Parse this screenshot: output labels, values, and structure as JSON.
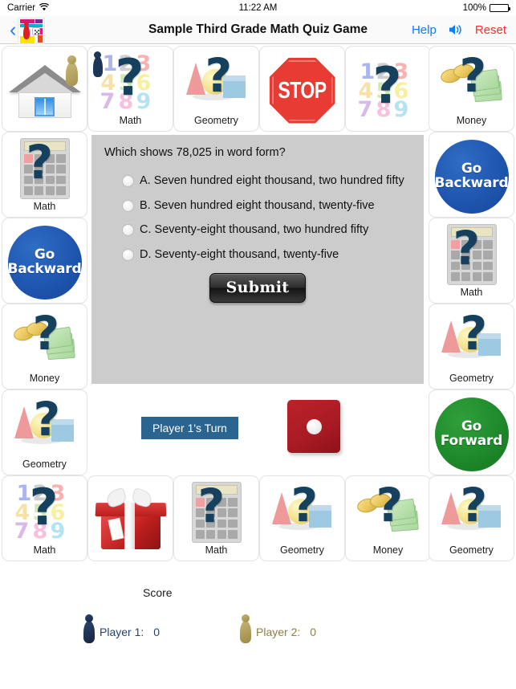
{
  "status_bar": {
    "carrier": "Carrier",
    "wifi_icon": "wifi-icon",
    "time": "11:22 AM",
    "battery_percent": "100%",
    "battery_icon": "battery-full-icon"
  },
  "nav_bar": {
    "back_icon": "back-chevron-icon",
    "app_icon": "board-game-app-icon",
    "title": "Sample Third Grade Math Quiz Game",
    "help_label": "Help",
    "sound_icon": "speaker-on-icon",
    "reset_label": "Reset"
  },
  "board": {
    "tiles": [
      {
        "id": "home",
        "label": "",
        "art": "house",
        "row": 0,
        "col": 0
      },
      {
        "id": "math-top-1",
        "label": "Math",
        "art": "numbers",
        "row": 0,
        "col": 1,
        "pawn": true
      },
      {
        "id": "geometry-top",
        "label": "Geometry",
        "art": "geometry",
        "row": 0,
        "col": 2
      },
      {
        "id": "stop",
        "label": "",
        "art": "stop",
        "row": 0,
        "col": 3
      },
      {
        "id": "math-top-2",
        "label": "",
        "art": "numbers",
        "row": 0,
        "col": 4
      },
      {
        "id": "money-top",
        "label": "Money",
        "art": "money",
        "row": 0,
        "col": 5
      },
      {
        "id": "math-left-1",
        "label": "Math",
        "art": "calc",
        "row": 1,
        "col": 0
      },
      {
        "id": "go-backward-left",
        "label": "Go Backward",
        "art": "circle-blue",
        "row": 2,
        "col": 0
      },
      {
        "id": "money-left",
        "label": "Money",
        "art": "money",
        "row": 3,
        "col": 0
      },
      {
        "id": "geometry-left",
        "label": "Geometry",
        "art": "geometry",
        "row": 4,
        "col": 0
      },
      {
        "id": "go-backward-right",
        "label": "Go Backward",
        "art": "circle-blue",
        "row": 1,
        "col": 5
      },
      {
        "id": "math-right",
        "label": "Math",
        "art": "calc",
        "row": 2,
        "col": 5
      },
      {
        "id": "geometry-right",
        "label": "Geometry",
        "art": "geometry",
        "row": 3,
        "col": 5
      },
      {
        "id": "go-forward",
        "label": "Go Forward",
        "art": "circle-green",
        "row": 4,
        "col": 5
      },
      {
        "id": "math-bot-1",
        "label": "Math",
        "art": "numbers",
        "row": 5,
        "col": 0
      },
      {
        "id": "gift",
        "label": "",
        "art": "gift",
        "row": 5,
        "col": 1
      },
      {
        "id": "math-bot-2",
        "label": "Math",
        "art": "calc",
        "row": 5,
        "col": 2
      },
      {
        "id": "geometry-bot-1",
        "label": "Geometry",
        "art": "geometry",
        "row": 5,
        "col": 3
      },
      {
        "id": "money-bot",
        "label": "Money",
        "art": "money",
        "row": 5,
        "col": 4
      },
      {
        "id": "geometry-bot-2",
        "label": "Geometry",
        "art": "geometry",
        "row": 5,
        "col": 5
      }
    ],
    "go_backward_label": "Go Backward",
    "go_forward_label": "Go Forward",
    "stop_label": "STOP"
  },
  "question": {
    "prompt": "Which shows 78,025 in word form?",
    "answers": [
      "A. Seven hundred eight thousand, two hundred fifty",
      "B. Seven hundred eight thousand, twenty-five",
      "C. Seventy-eight thousand, two hundred fifty",
      "D. Seventy-eight thousand, twenty-five"
    ],
    "submit_label": "Submit"
  },
  "turn": {
    "badge_label": "Player 1's Turn",
    "dice_value": "1"
  },
  "score": {
    "title": "Score",
    "players": [
      {
        "name": "Player 1:",
        "value": "0",
        "color": "#25436e"
      },
      {
        "name": "Player 2:",
        "value": "0",
        "color": "#8f8040"
      }
    ]
  },
  "colors": {
    "accent_blue": "#0a7cff",
    "reset_red": "#ff2d2d",
    "go_backward_blue": "#1f56b0",
    "go_forward_green": "#1e8a2b",
    "stop_red": "#e83b33",
    "panel_gray": "#cccccc",
    "turn_badge_blue": "#2a6490",
    "dice_red": "#a81b24"
  }
}
